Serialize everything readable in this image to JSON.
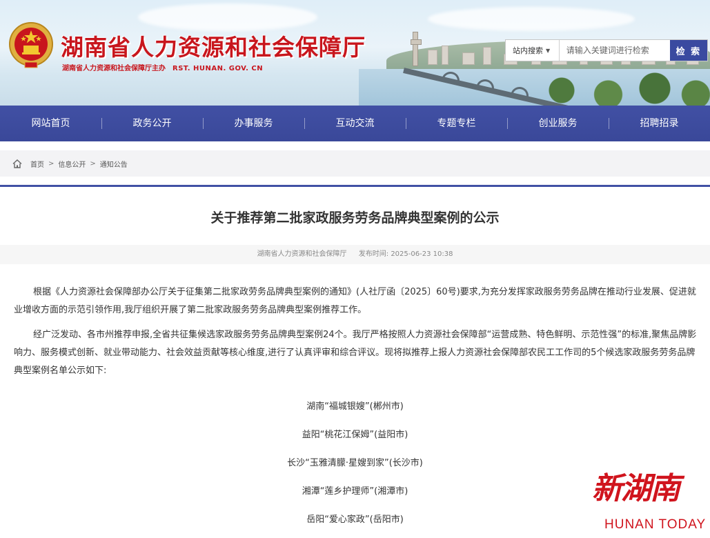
{
  "header": {
    "site_title": "湖南省人力资源和社会保障厅",
    "site_sub_cn": "湖南省人力资源和社会保障厅主办",
    "site_sub_en": "RST. HUNAN. GOV. CN",
    "emblem_icon": "national-emblem-icon",
    "brand_color": "#c8161d"
  },
  "search": {
    "scope_label": "站内搜索",
    "placeholder": "请输入关键词进行检索",
    "button_label": "检 索"
  },
  "nav": {
    "items": [
      "网站首页",
      "政务公开",
      "办事服务",
      "互动交流",
      "专题专栏",
      "创业服务",
      "招聘招录"
    ],
    "color": "#3f4ea2"
  },
  "breadcrumb": {
    "home_icon": "home-icon",
    "items": [
      "首页",
      "信息公开",
      "通知公告"
    ],
    "separator": ">"
  },
  "article": {
    "title": "关于推荐第二批家政服务劳务品牌典型案例的公示",
    "source": "湖南省人力资源和社会保障厅",
    "date_label": "发布时间:",
    "date": "2025-06-23 10:38",
    "paragraphs": [
      "根据《人力资源社会保障部办公厅关于征集第二批家政劳务品牌典型案例的通知》(人社厅函〔2025〕60号)要求,为充分发挥家政服务劳务品牌在推动行业发展、促进就业增收方面的示范引领作用,我厅组织开展了第二批家政服务劳务品牌典型案例推荐工作。",
      "经广泛发动、各市州推荐申报,全省共征集候选家政服务劳务品牌典型案例24个。我厅严格按照人力资源社会保障部“运营成熟、特色鲜明、示范性强”的标准,聚焦品牌影响力、服务模式创新、就业带动能力、社会效益贡献等核心维度,进行了认真评审和综合评议。现将拟推荐上报人力资源社会保障部农民工工作司的5个候选家政服务劳务品牌典型案例名单公示如下:"
    ],
    "cases": [
      "湖南“福城银嫂”(郴州市)",
      "益阳“桃花江保姆”(益阳市)",
      "长沙“玉雅清朦·星嫂到家”(长沙市)",
      "湘潭“莲乡护理师”(湘潭市)",
      "岳阳“爱心家政”(岳阳市)"
    ]
  },
  "watermark": {
    "cn": "新湖南",
    "en": "HUNAN TODAY"
  }
}
